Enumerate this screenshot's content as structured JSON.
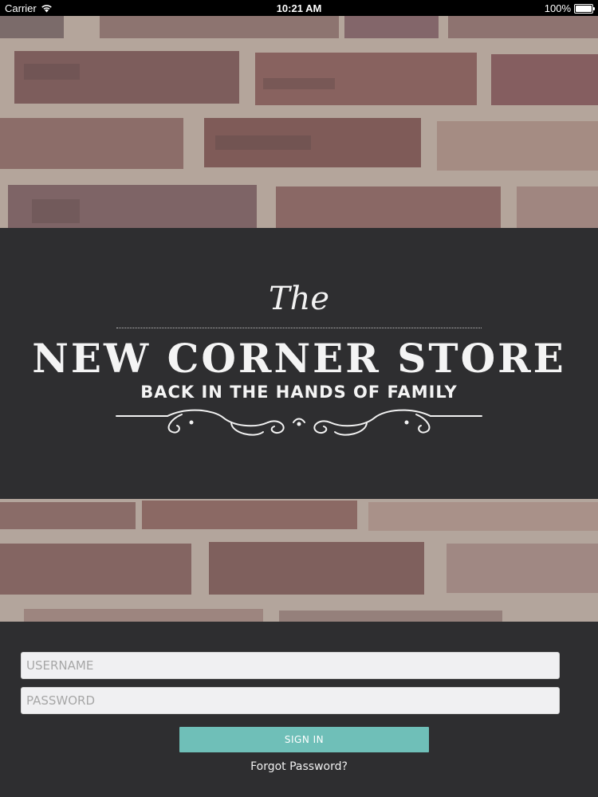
{
  "status_bar": {
    "carrier": "Carrier",
    "time": "10:21 AM",
    "battery": "100%",
    "icons": [
      "wifi-icon",
      "battery-icon"
    ]
  },
  "logo": {
    "the": "The",
    "title": "NEW CORNER STORE",
    "tagline": "BACK IN THE HANDS OF FAMILY"
  },
  "login_form": {
    "username_placeholder": "USERNAME",
    "username_value": "",
    "password_placeholder": "PASSWORD",
    "password_value": "",
    "signin_label": "SIGN IN",
    "forgot_password": "Forgot Password?"
  },
  "colors": {
    "background": "#2e2e30",
    "accent": "#6fbfb8",
    "field": "#f0f0f2"
  }
}
